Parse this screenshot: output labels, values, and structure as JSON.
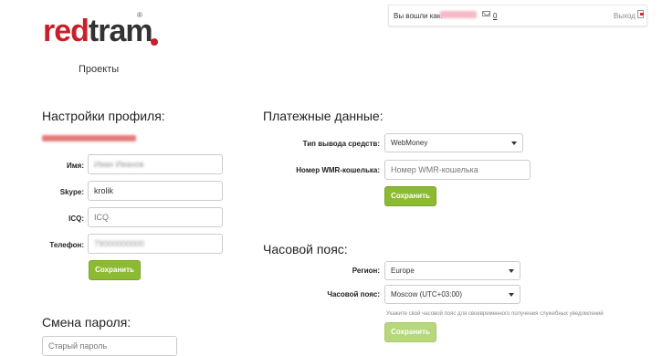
{
  "logo": {
    "part1": "red",
    "part2": "tram",
    "reg": "®"
  },
  "header": {
    "logged_in_as": "Вы вошли как:",
    "message_count": "0",
    "logout": "Выход"
  },
  "nav": {
    "projects": "Проекты"
  },
  "profile": {
    "title": "Настройки профиля:",
    "name_label": "Имя:",
    "skype_label": "Skype:",
    "skype_value": "krolik",
    "icq_label": "ICQ:",
    "icq_placeholder": "ICQ",
    "phone_label": "Телефон:",
    "save": "Сохранить"
  },
  "payment": {
    "title": "Платежные данные:",
    "method_label": "Тип вывода средств:",
    "method_value": "WebMoney",
    "wmr_label": "Номер WMR-кошелька:",
    "wmr_placeholder": "Номер WMR-кошелька",
    "save": "Сохранить"
  },
  "timezone": {
    "title": "Часовой пояс:",
    "region_label": "Регион:",
    "region_value": "Europe",
    "tz_label": "Часовой пояс:",
    "tz_value": "Moscow (UTC+03:00)",
    "hint": "Укажите свой часовой пояс для своевременного получения служебных уведомлений",
    "save": "Сохранить"
  },
  "password": {
    "title": "Смена пароля:",
    "old_placeholder": "Старый пароль"
  },
  "colors": {
    "brand_red": "#c8202a",
    "accent_green": "#8dba33"
  }
}
